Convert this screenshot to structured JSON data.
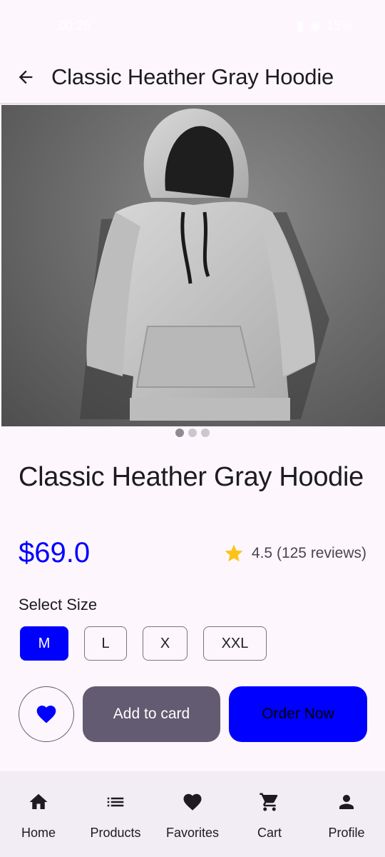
{
  "status_bar": {
    "time": "00:25",
    "battery": "15%"
  },
  "app_bar": {
    "title": "Classic Heather Gray Hoodie",
    "back_icon": "arrow-back-icon"
  },
  "carousel": {
    "image_description": "hoodie-photo",
    "page_count": 3,
    "active_index": 0
  },
  "product": {
    "name": "Classic Heather Gray Hoodie",
    "price": "$69.0",
    "rating_text": "4.5 (125 reviews)",
    "rating_value": 4.5,
    "star_color": "#fcc419"
  },
  "sizes": {
    "label": "Select Size",
    "options": [
      "M",
      "L",
      "X",
      "XXL"
    ],
    "selected": "M"
  },
  "actions": {
    "favorite_icon": "heart-icon",
    "add_label": "Add to card",
    "order_label": "Order Now"
  },
  "colors": {
    "accent": "#0000ff",
    "secondary": "#625b71"
  },
  "nav": {
    "items": [
      {
        "label": "Home",
        "icon": "home-icon"
      },
      {
        "label": "Products",
        "icon": "list-icon"
      },
      {
        "label": "Favorites",
        "icon": "heart-icon"
      },
      {
        "label": "Cart",
        "icon": "cart-icon"
      },
      {
        "label": "Profile",
        "icon": "person-icon"
      }
    ]
  }
}
